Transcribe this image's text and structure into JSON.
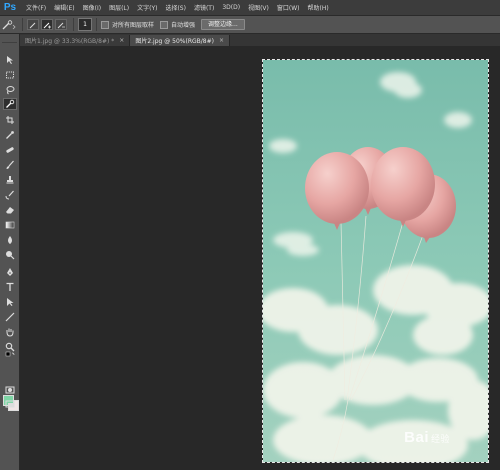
{
  "app": {
    "logo": "Ps"
  },
  "menu": [
    "文件(F)",
    "编辑(E)",
    "图像(I)",
    "图层(L)",
    "文字(Y)",
    "选择(S)",
    "滤镜(T)",
    "3D(D)",
    "视图(V)",
    "窗口(W)",
    "帮助(H)"
  ],
  "options": {
    "brush_size": "1",
    "sample_all_layers": "对所有图层取样",
    "auto_enhance": "自动增强",
    "refine_edge": "调整边缘..."
  },
  "tabs": [
    {
      "label": "图片1.jpg @ 33.3%(RGB/8#) *",
      "active": false
    },
    {
      "label": "图片2.jpg @ 50%(RGB/8#)",
      "active": true
    }
  ],
  "colors": {
    "foreground": "#7fd6a6",
    "background": "#f0e6e6",
    "accent": "#31a8ff"
  },
  "toolbox_icons": [
    "move-icon",
    "marquee-icon",
    "lasso-icon",
    "quick-selection-icon",
    "crop-icon",
    "eyedropper-icon",
    "healing-brush-icon",
    "brush-icon",
    "clone-stamp-icon",
    "history-brush-icon",
    "eraser-icon",
    "gradient-icon",
    "blur-icon",
    "dodge-icon",
    "pen-icon",
    "type-icon",
    "path-selection-icon",
    "rectangle-icon",
    "hand-icon",
    "zoom-icon"
  ],
  "watermark": {
    "text": "Bai",
    "suffix": "经验"
  }
}
